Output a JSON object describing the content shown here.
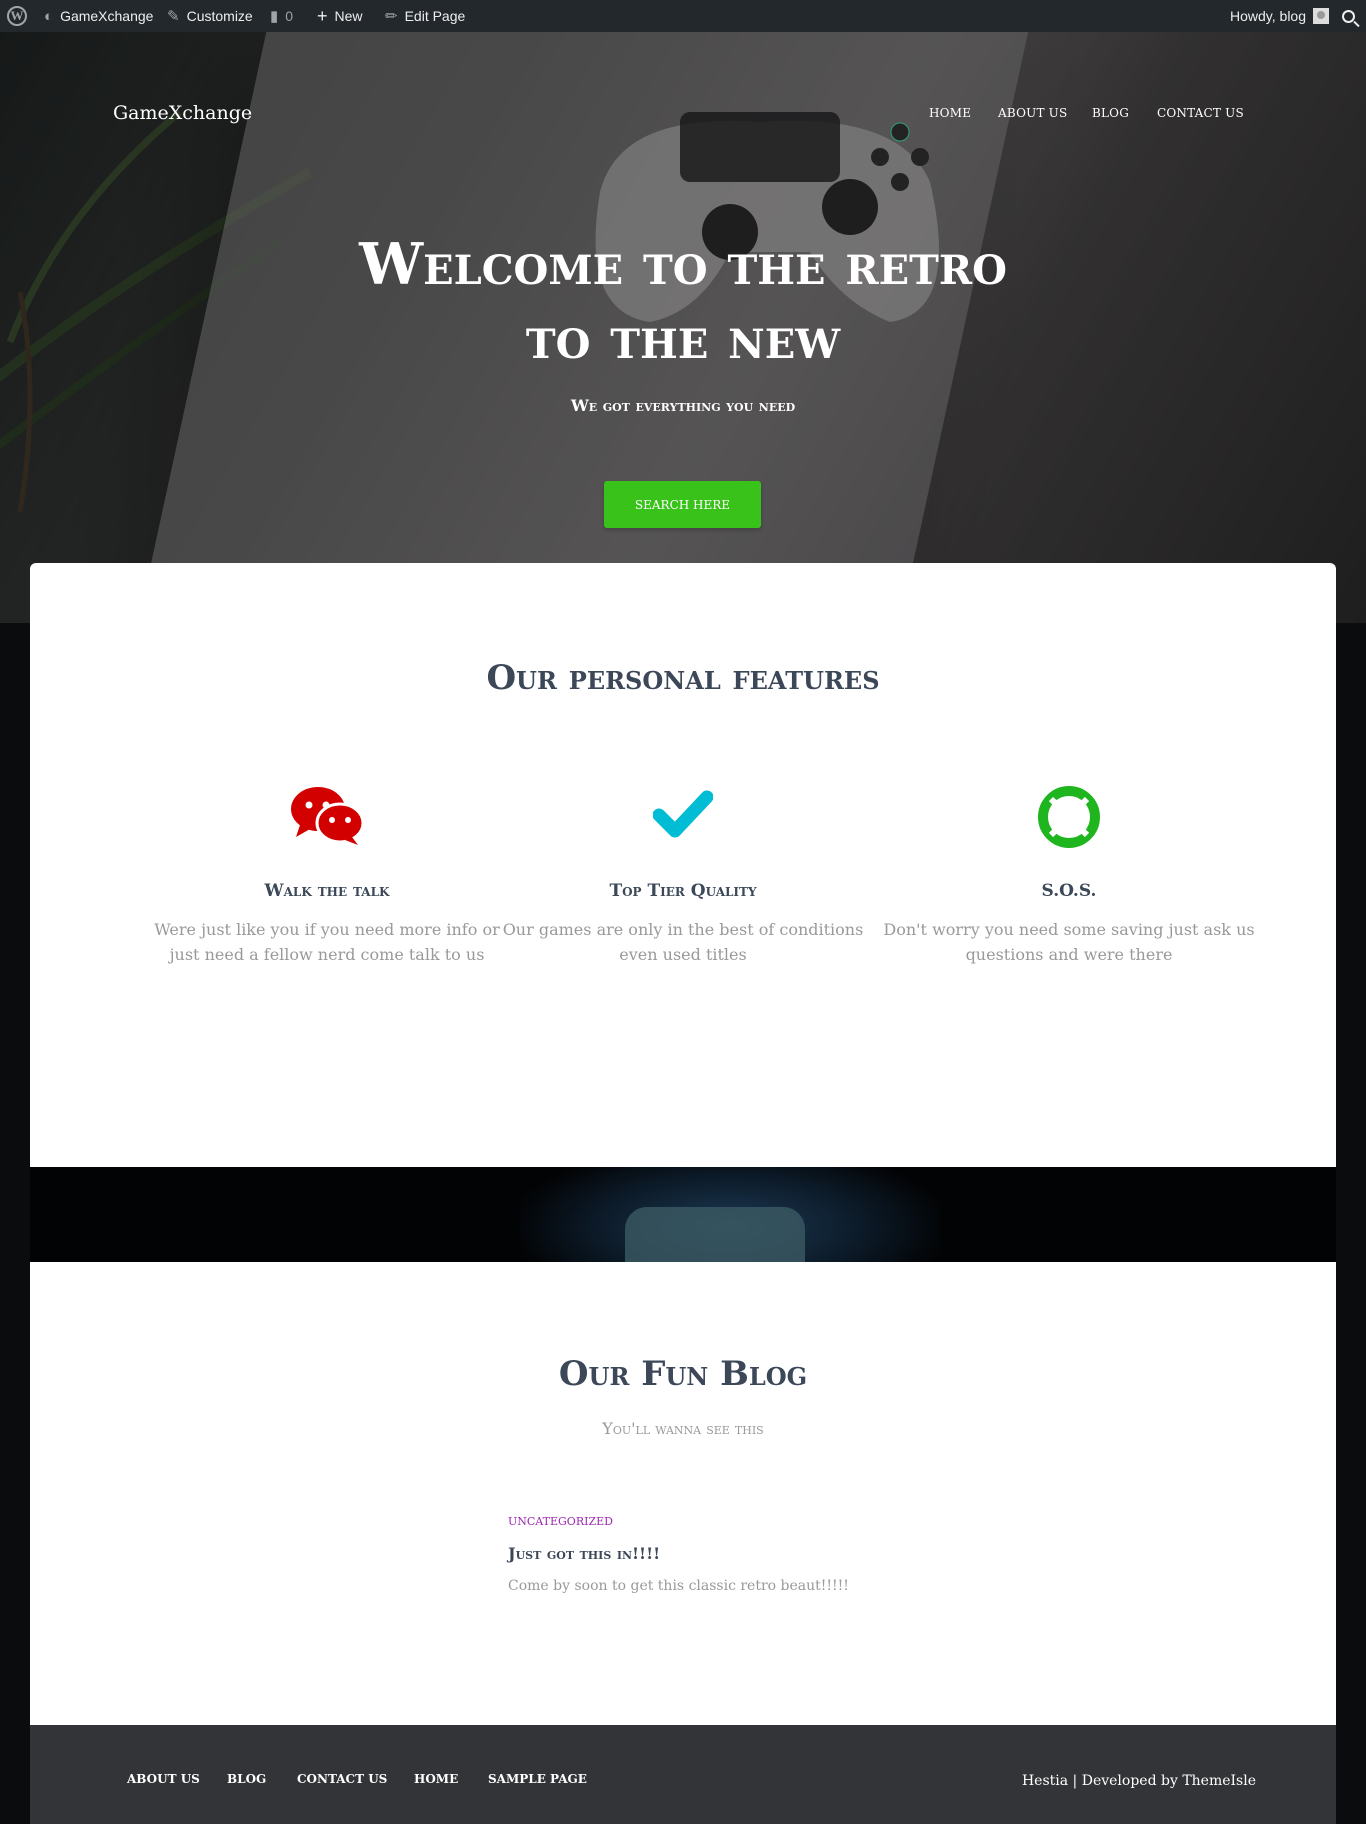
{
  "admin_bar": {
    "site_name": "GameXchange",
    "customize": "Customize",
    "comments_count": "0",
    "new_label": "New",
    "edit_page": "Edit Page",
    "howdy": "Howdy, blog"
  },
  "header": {
    "brand": "GameXchange",
    "nav": [
      "HOME",
      "ABOUT US",
      "BLOG",
      "CONTACT US"
    ]
  },
  "hero": {
    "title_line1": "Welcome to the retro",
    "title_line2": "to the new",
    "subtitle": "We got everything you need",
    "button": "SEARCH HERE",
    "button_color": "#38c21a"
  },
  "features": {
    "title": "Our personal features",
    "items": [
      {
        "icon": "wechat-icon",
        "color": "#d30000",
        "title": "Walk the talk",
        "text": "Were just like you if you need more info or just need a fellow nerd come talk to us"
      },
      {
        "icon": "check-icon",
        "color": "#00bcd4",
        "title": "Top Tier Quality",
        "text": "Our games are only in the best of conditions even used titles"
      },
      {
        "icon": "life-ring-icon",
        "color": "#1fb51f",
        "title": "S.O.S.",
        "text": "Don't worry you need some saving just ask us questions and were there"
      }
    ]
  },
  "blog": {
    "title": "Our Fun Blog",
    "subtitle": "You'll wanna see this",
    "post": {
      "category": "UNCATEGORIZED",
      "title": "Just got this in!!!!",
      "excerpt": "Come by soon to get this classic retro beaut!!!!!"
    }
  },
  "footer": {
    "links": [
      "ABOUT US",
      "BLOG",
      "CONTACT US",
      "HOME",
      "SAMPLE PAGE"
    ],
    "credit_prefix": "Hestia | Developed by",
    "credit_link": "ThemeIsle"
  }
}
